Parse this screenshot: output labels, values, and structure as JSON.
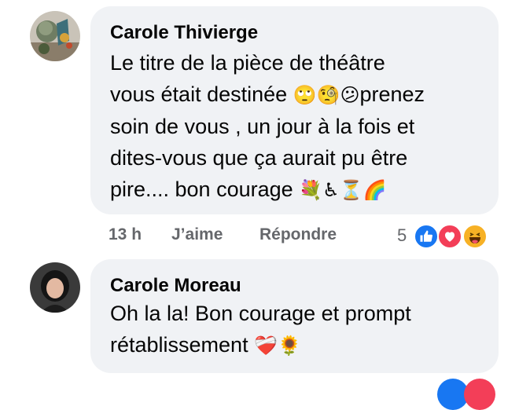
{
  "comments": [
    {
      "author": "Carole Thivierge",
      "lines": [
        "Le titre de la pièce de théâtre",
        "vous était destinée",
        "prenez",
        "soin de vous , un jour à la fois et",
        "dites-vous que ça aurait pu être",
        "pire.... bon courage"
      ],
      "emojis_line2": [
        "🙄",
        "🧐",
        "😕"
      ],
      "emojis_end": [
        "💐",
        "♿",
        "⏳",
        "🌈"
      ],
      "time": "13 h",
      "like_label": "J’aime",
      "reply_label": "Répondre",
      "reaction_count": "5",
      "reactions": [
        "like-icon",
        "love-icon",
        "haha-icon"
      ]
    },
    {
      "author": "Carole Moreau",
      "lines": [
        "Oh la la! Bon courage et prompt",
        "rétablissement"
      ],
      "emojis_end": [
        "❤️‍🩹",
        "🌻"
      ]
    }
  ],
  "colors": {
    "bubble": "#f0f2f5",
    "muted": "#65676b",
    "like": "#1877f2",
    "love": "#f33e58",
    "haha": "#f7b125"
  }
}
